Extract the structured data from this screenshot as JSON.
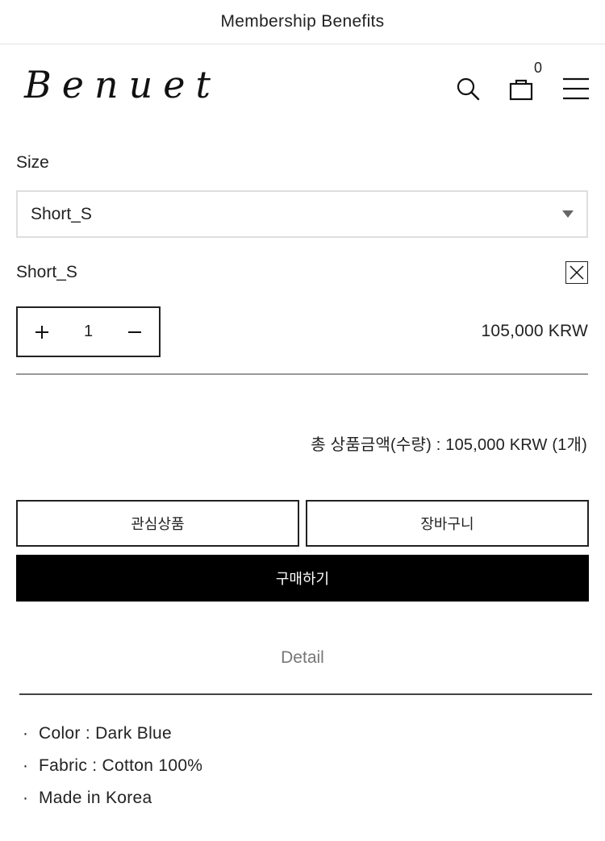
{
  "topbar": {
    "label": "Membership Benefits"
  },
  "header": {
    "logo": "Benuet",
    "cart_count": "0"
  },
  "option": {
    "size_label": "Size",
    "selected_value": "Short_S",
    "selected_item_name": "Short_S",
    "quantity": "1",
    "line_price": "105,000 KRW"
  },
  "summary": {
    "total_text": "총 상품금액(수량) : 105,000 KRW (1개)"
  },
  "actions": {
    "wishlist_label": "관심상품",
    "cart_label": "장바구니",
    "buy_label": "구매하기"
  },
  "detail": {
    "tab_label": "Detail",
    "items": [
      "Color : Dark Blue",
      "Fabric : Cotton 100%",
      "Made in Korea"
    ]
  }
}
